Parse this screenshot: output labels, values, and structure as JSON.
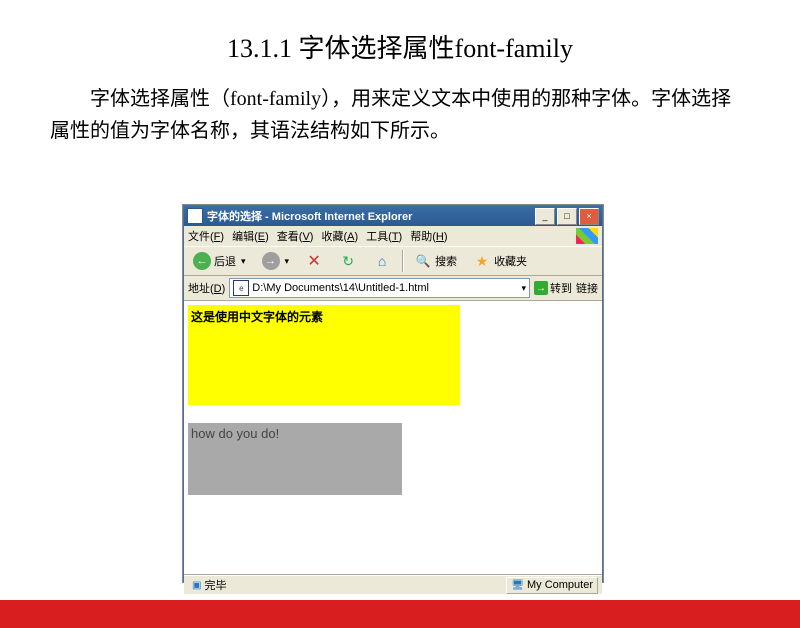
{
  "slide": {
    "title": "13.1.1  字体选择属性font-family",
    "body": "字体选择属性（font-family），用来定义文本中使用的那种字体。字体选择属性的值为字体名称，其语法结构如下所示。"
  },
  "ie": {
    "title": "字体的选择 - Microsoft Internet Explorer",
    "menu": {
      "file": "文件",
      "file_k": "F",
      "edit": "编辑",
      "edit_k": "E",
      "view": "查看",
      "view_k": "V",
      "fav": "收藏",
      "fav_k": "A",
      "tools": "工具",
      "tools_k": "T",
      "help": "帮助",
      "help_k": "H"
    },
    "toolbar": {
      "back": "后退",
      "search": "搜索",
      "favorites": "收藏夹"
    },
    "address": {
      "label": "地址",
      "label_k": "D",
      "path": "D:\\My Documents\\14\\Untitled-1.html",
      "go": "转到",
      "links": "链接"
    },
    "content": {
      "yellow_text": "这是使用中文字体的元素",
      "gray_text": "how do you do!"
    },
    "status": {
      "done": "完毕",
      "zone": "My Computer"
    }
  }
}
